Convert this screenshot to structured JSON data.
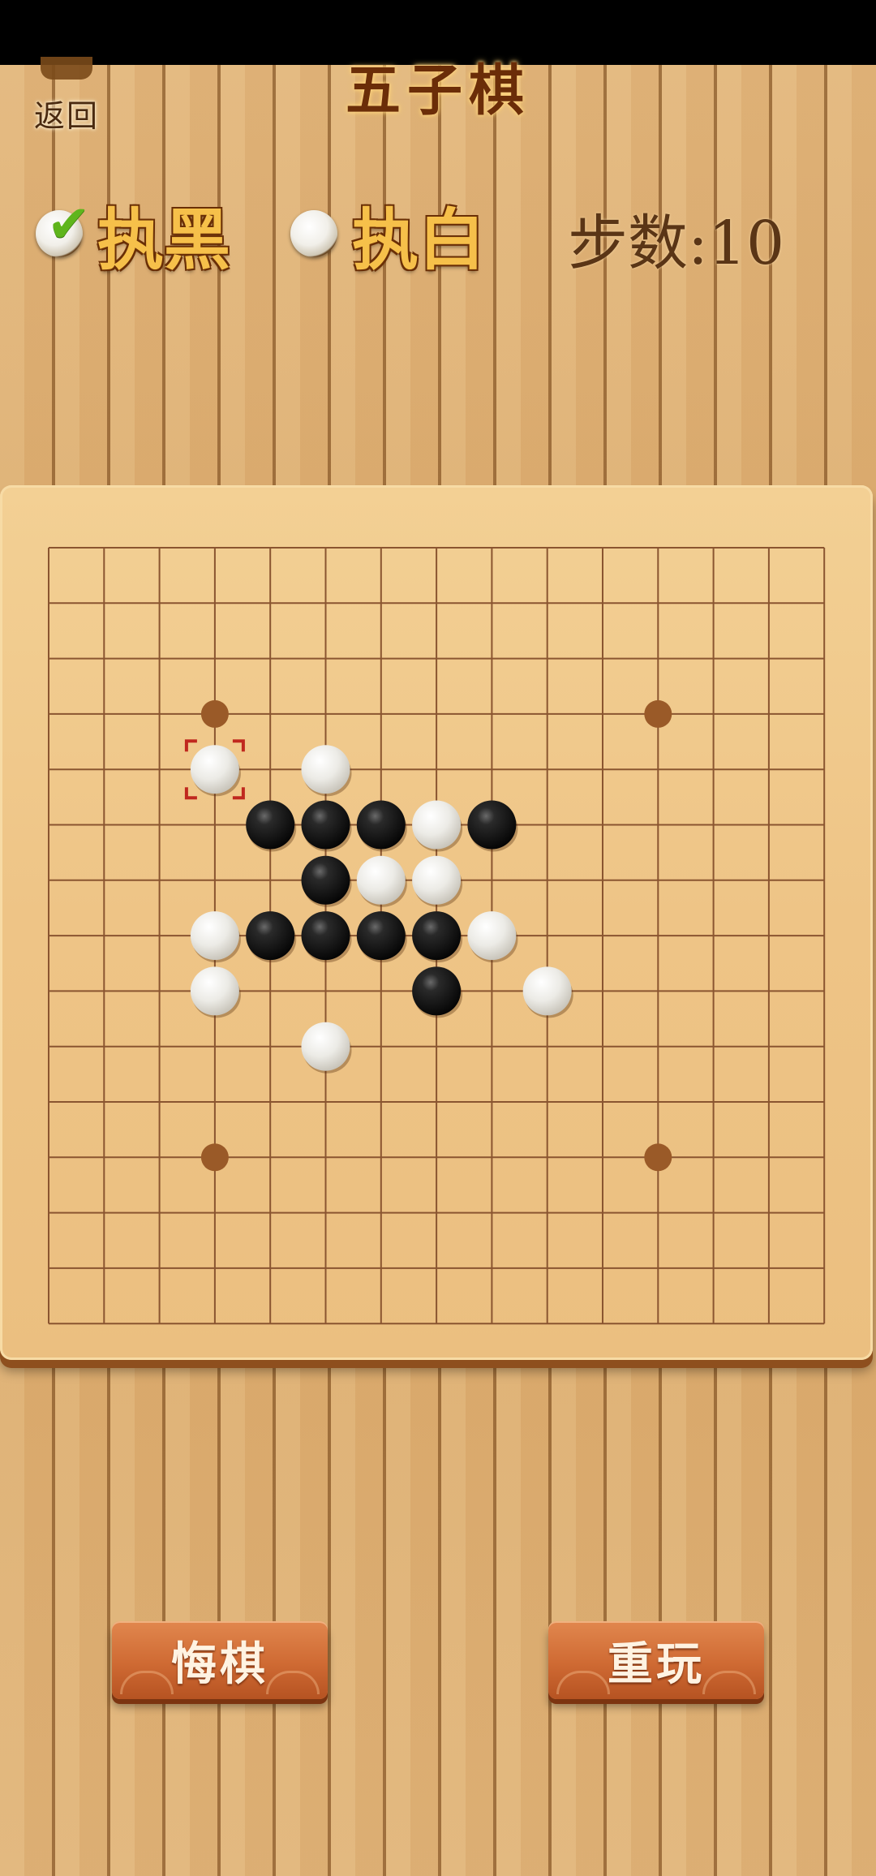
{
  "status_bar": {},
  "header": {
    "back_label": "返回",
    "title": "五子棋"
  },
  "options": {
    "black_label": "执黑",
    "white_label": "执白",
    "black_checked": true,
    "white_checked": false,
    "steps_text": "步数:10"
  },
  "board": {
    "size": 15,
    "star_points": [
      [
        3,
        3
      ],
      [
        11,
        3
      ],
      [
        3,
        11
      ],
      [
        11,
        11
      ]
    ],
    "last_move": [
      3,
      4
    ],
    "stones": [
      {
        "col": 3,
        "row": 4,
        "color": "white"
      },
      {
        "col": 5,
        "row": 4,
        "color": "white"
      },
      {
        "col": 4,
        "row": 5,
        "color": "black"
      },
      {
        "col": 5,
        "row": 5,
        "color": "black"
      },
      {
        "col": 6,
        "row": 5,
        "color": "black"
      },
      {
        "col": 7,
        "row": 5,
        "color": "white"
      },
      {
        "col": 8,
        "row": 5,
        "color": "black"
      },
      {
        "col": 5,
        "row": 6,
        "color": "black"
      },
      {
        "col": 6,
        "row": 6,
        "color": "white"
      },
      {
        "col": 7,
        "row": 6,
        "color": "white"
      },
      {
        "col": 3,
        "row": 7,
        "color": "white"
      },
      {
        "col": 4,
        "row": 7,
        "color": "black"
      },
      {
        "col": 5,
        "row": 7,
        "color": "black"
      },
      {
        "col": 6,
        "row": 7,
        "color": "black"
      },
      {
        "col": 7,
        "row": 7,
        "color": "black"
      },
      {
        "col": 8,
        "row": 7,
        "color": "white"
      },
      {
        "col": 3,
        "row": 8,
        "color": "white"
      },
      {
        "col": 7,
        "row": 8,
        "color": "black"
      },
      {
        "col": 9,
        "row": 8,
        "color": "white"
      },
      {
        "col": 5,
        "row": 9,
        "color": "white"
      }
    ]
  },
  "buttons": {
    "undo_label": "悔棋",
    "replay_label": "重玩"
  },
  "colors": {
    "grid_line": "#8a5530",
    "star_point": "#9a5a28",
    "last_move_marker": "#c0281e"
  }
}
